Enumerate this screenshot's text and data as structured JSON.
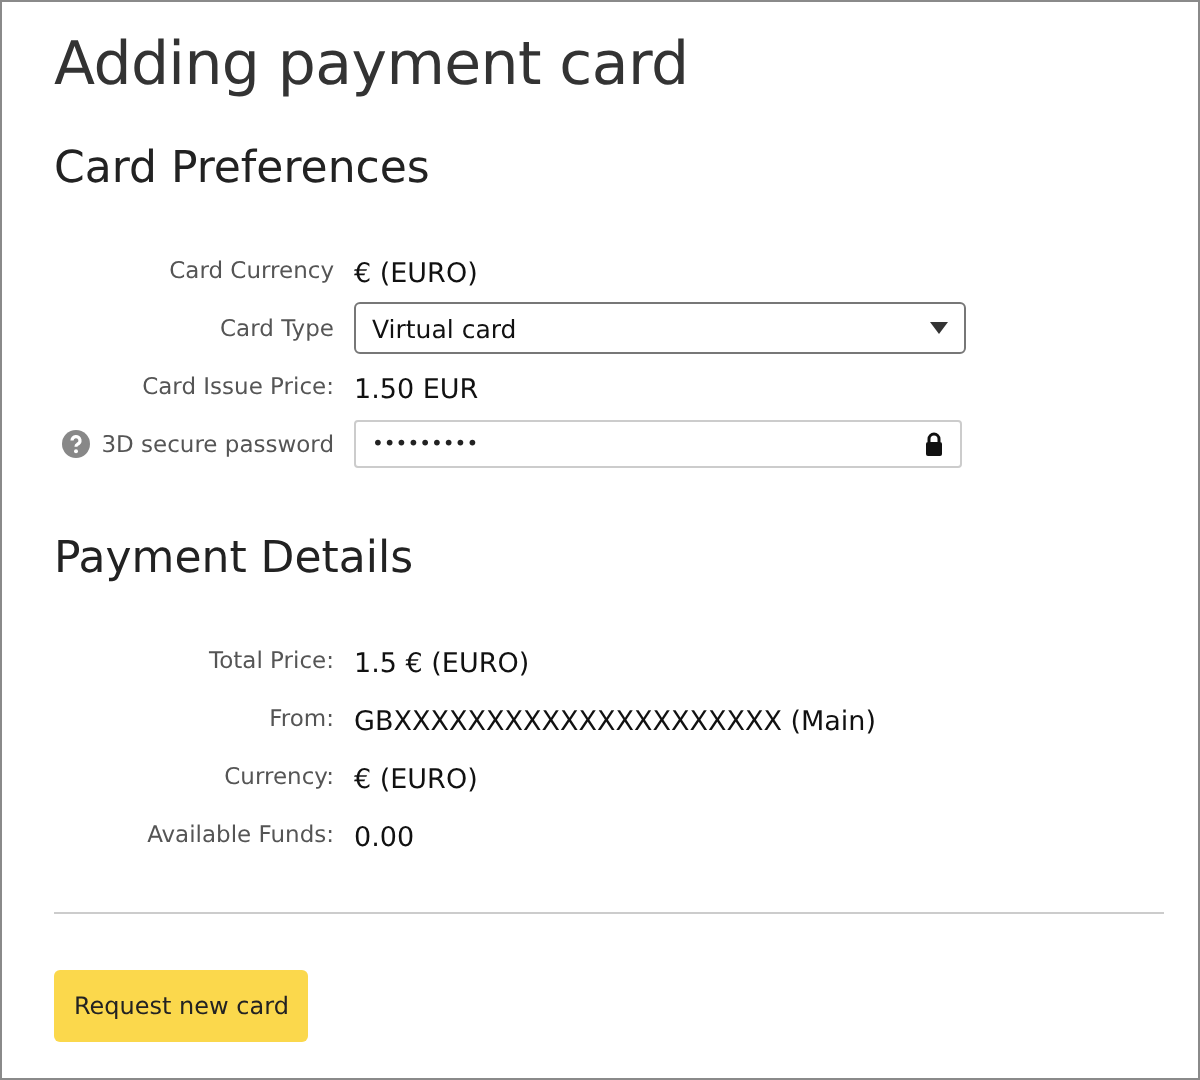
{
  "title": "Adding payment card",
  "sections": [
    {
      "heading": "Card Preferences",
      "rows": [
        {
          "kind": "text",
          "label": "Card Currency",
          "value": "€ (EURO)"
        },
        {
          "kind": "select",
          "label": "Card Type",
          "value": "Virtual card"
        },
        {
          "kind": "text",
          "label": "Card Issue Price:",
          "value": "1.50 EUR"
        },
        {
          "kind": "password",
          "label": "3D secure password",
          "value": "•••••••••",
          "help": true
        }
      ]
    },
    {
      "heading": "Payment Details",
      "rows": [
        {
          "kind": "text",
          "label": "Total Price:",
          "value": "1.5 € (EURO)"
        },
        {
          "kind": "text",
          "label": "From:",
          "value": "GBXXXXXXXXXXXXXXXXXXXXX (Main)"
        },
        {
          "kind": "text",
          "label": "Currency:",
          "value": "€ (EURO)"
        },
        {
          "kind": "text",
          "label": "Available Funds:",
          "value": "0.00"
        }
      ]
    }
  ],
  "button": "Request new card"
}
